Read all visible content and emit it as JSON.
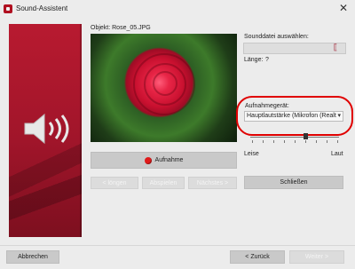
{
  "window": {
    "title": "Sound-Assistent",
    "close_glyph": "✕",
    "app_icon": "app-logo-icon"
  },
  "object_label": "Objekt: Rose_05.JPG",
  "sound_file": {
    "label": "Sounddatei auswählen:",
    "value": "",
    "browse_glyph": "⟦",
    "length_label": "Länge:",
    "length_value": "?"
  },
  "recording": {
    "device_label": "Aufnahmegerät:",
    "device_value": "Hauptlautstärke (Mikrofon (Realt",
    "dropdown_glyph": "▾",
    "volume_min_label": "Leise",
    "volume_max_label": "Laut",
    "volume_level": 0.62
  },
  "buttons": {
    "record": "Aufnahme",
    "delete": "< löngen",
    "play": "Abspielen",
    "next_small": "Nächstes >",
    "close": "Schließen",
    "cancel": "Abbrechen",
    "back": "< Zurück",
    "next": "Weiter >"
  },
  "colors": {
    "accent": "#a0152a",
    "highlight_ring": "#e00000"
  }
}
